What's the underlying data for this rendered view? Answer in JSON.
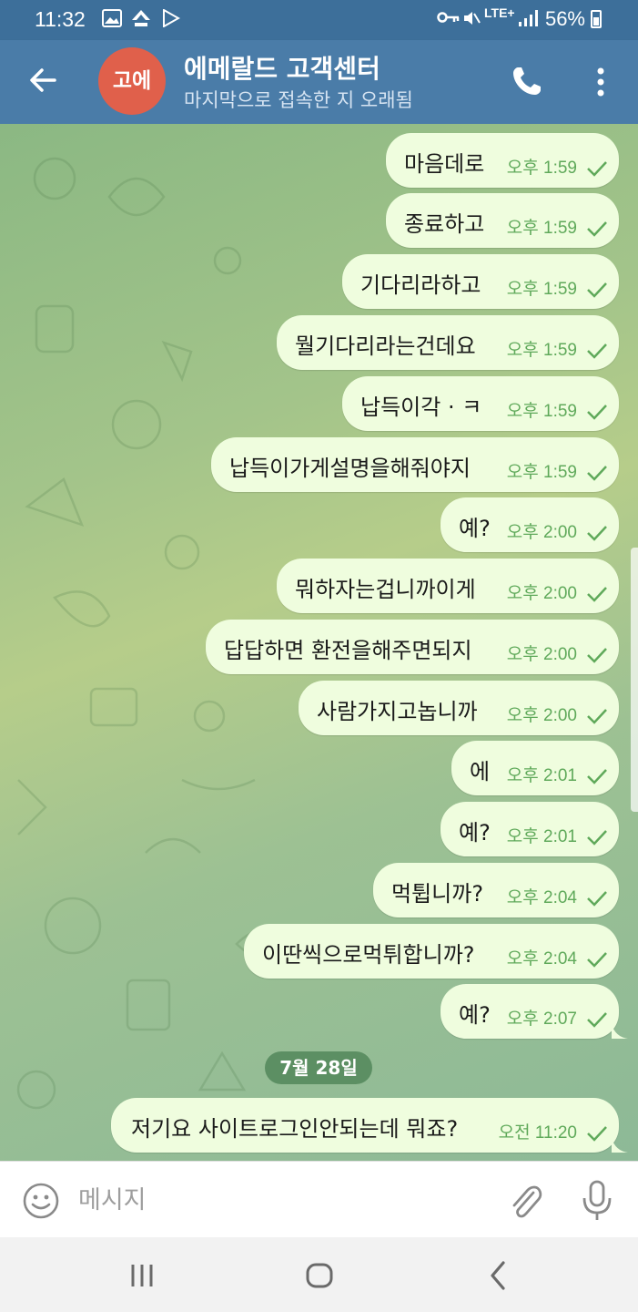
{
  "status_bar": {
    "time": "11:32",
    "network": "LTE+",
    "battery": "56%"
  },
  "header": {
    "avatar_initials": "고에",
    "title": "에메랄드 고객센터",
    "subtitle": "마지막으로 접속한 지 오래됨"
  },
  "messages": [
    {
      "text": "마음데로",
      "time": "오후 1:59"
    },
    {
      "text": "종료하고",
      "time": "오후 1:59"
    },
    {
      "text": "기다리라하고",
      "time": "오후 1:59"
    },
    {
      "text": "뭘기다리라는건데요",
      "time": "오후 1:59"
    },
    {
      "text": "납득이각 · ㅋ",
      "time": "오후 1:59"
    },
    {
      "text": "납득이가게설명을해줘야지",
      "time": "오후 1:59"
    },
    {
      "text": "예?",
      "time": "오후 2:00"
    },
    {
      "text": "뭐하자는겁니까이게",
      "time": "오후 2:00"
    },
    {
      "text": "답답하면 환전을해주면되지",
      "time": "오후 2:00"
    },
    {
      "text": "사람가지고놉니까",
      "time": "오후 2:00"
    },
    {
      "text": "에",
      "time": "오후 2:01"
    },
    {
      "text": "예?",
      "time": "오후 2:01"
    },
    {
      "text": "먹튑니까?",
      "time": "오후 2:04"
    },
    {
      "text": "이딴씩으로먹튀합니까?",
      "time": "오후 2:04"
    },
    {
      "text": "예?",
      "time": "오후 2:07"
    },
    {
      "text": "저기요 사이트로그인안되는데 뭐죠?",
      "time": "오전 11:20"
    }
  ],
  "date_separator": "7월 28일",
  "input": {
    "placeholder": "메시지"
  },
  "colors": {
    "header_bg": "#4a7ca8",
    "bubble_bg": "#effdde",
    "time_color": "#5fa95a",
    "avatar_bg": "#e0604b"
  }
}
